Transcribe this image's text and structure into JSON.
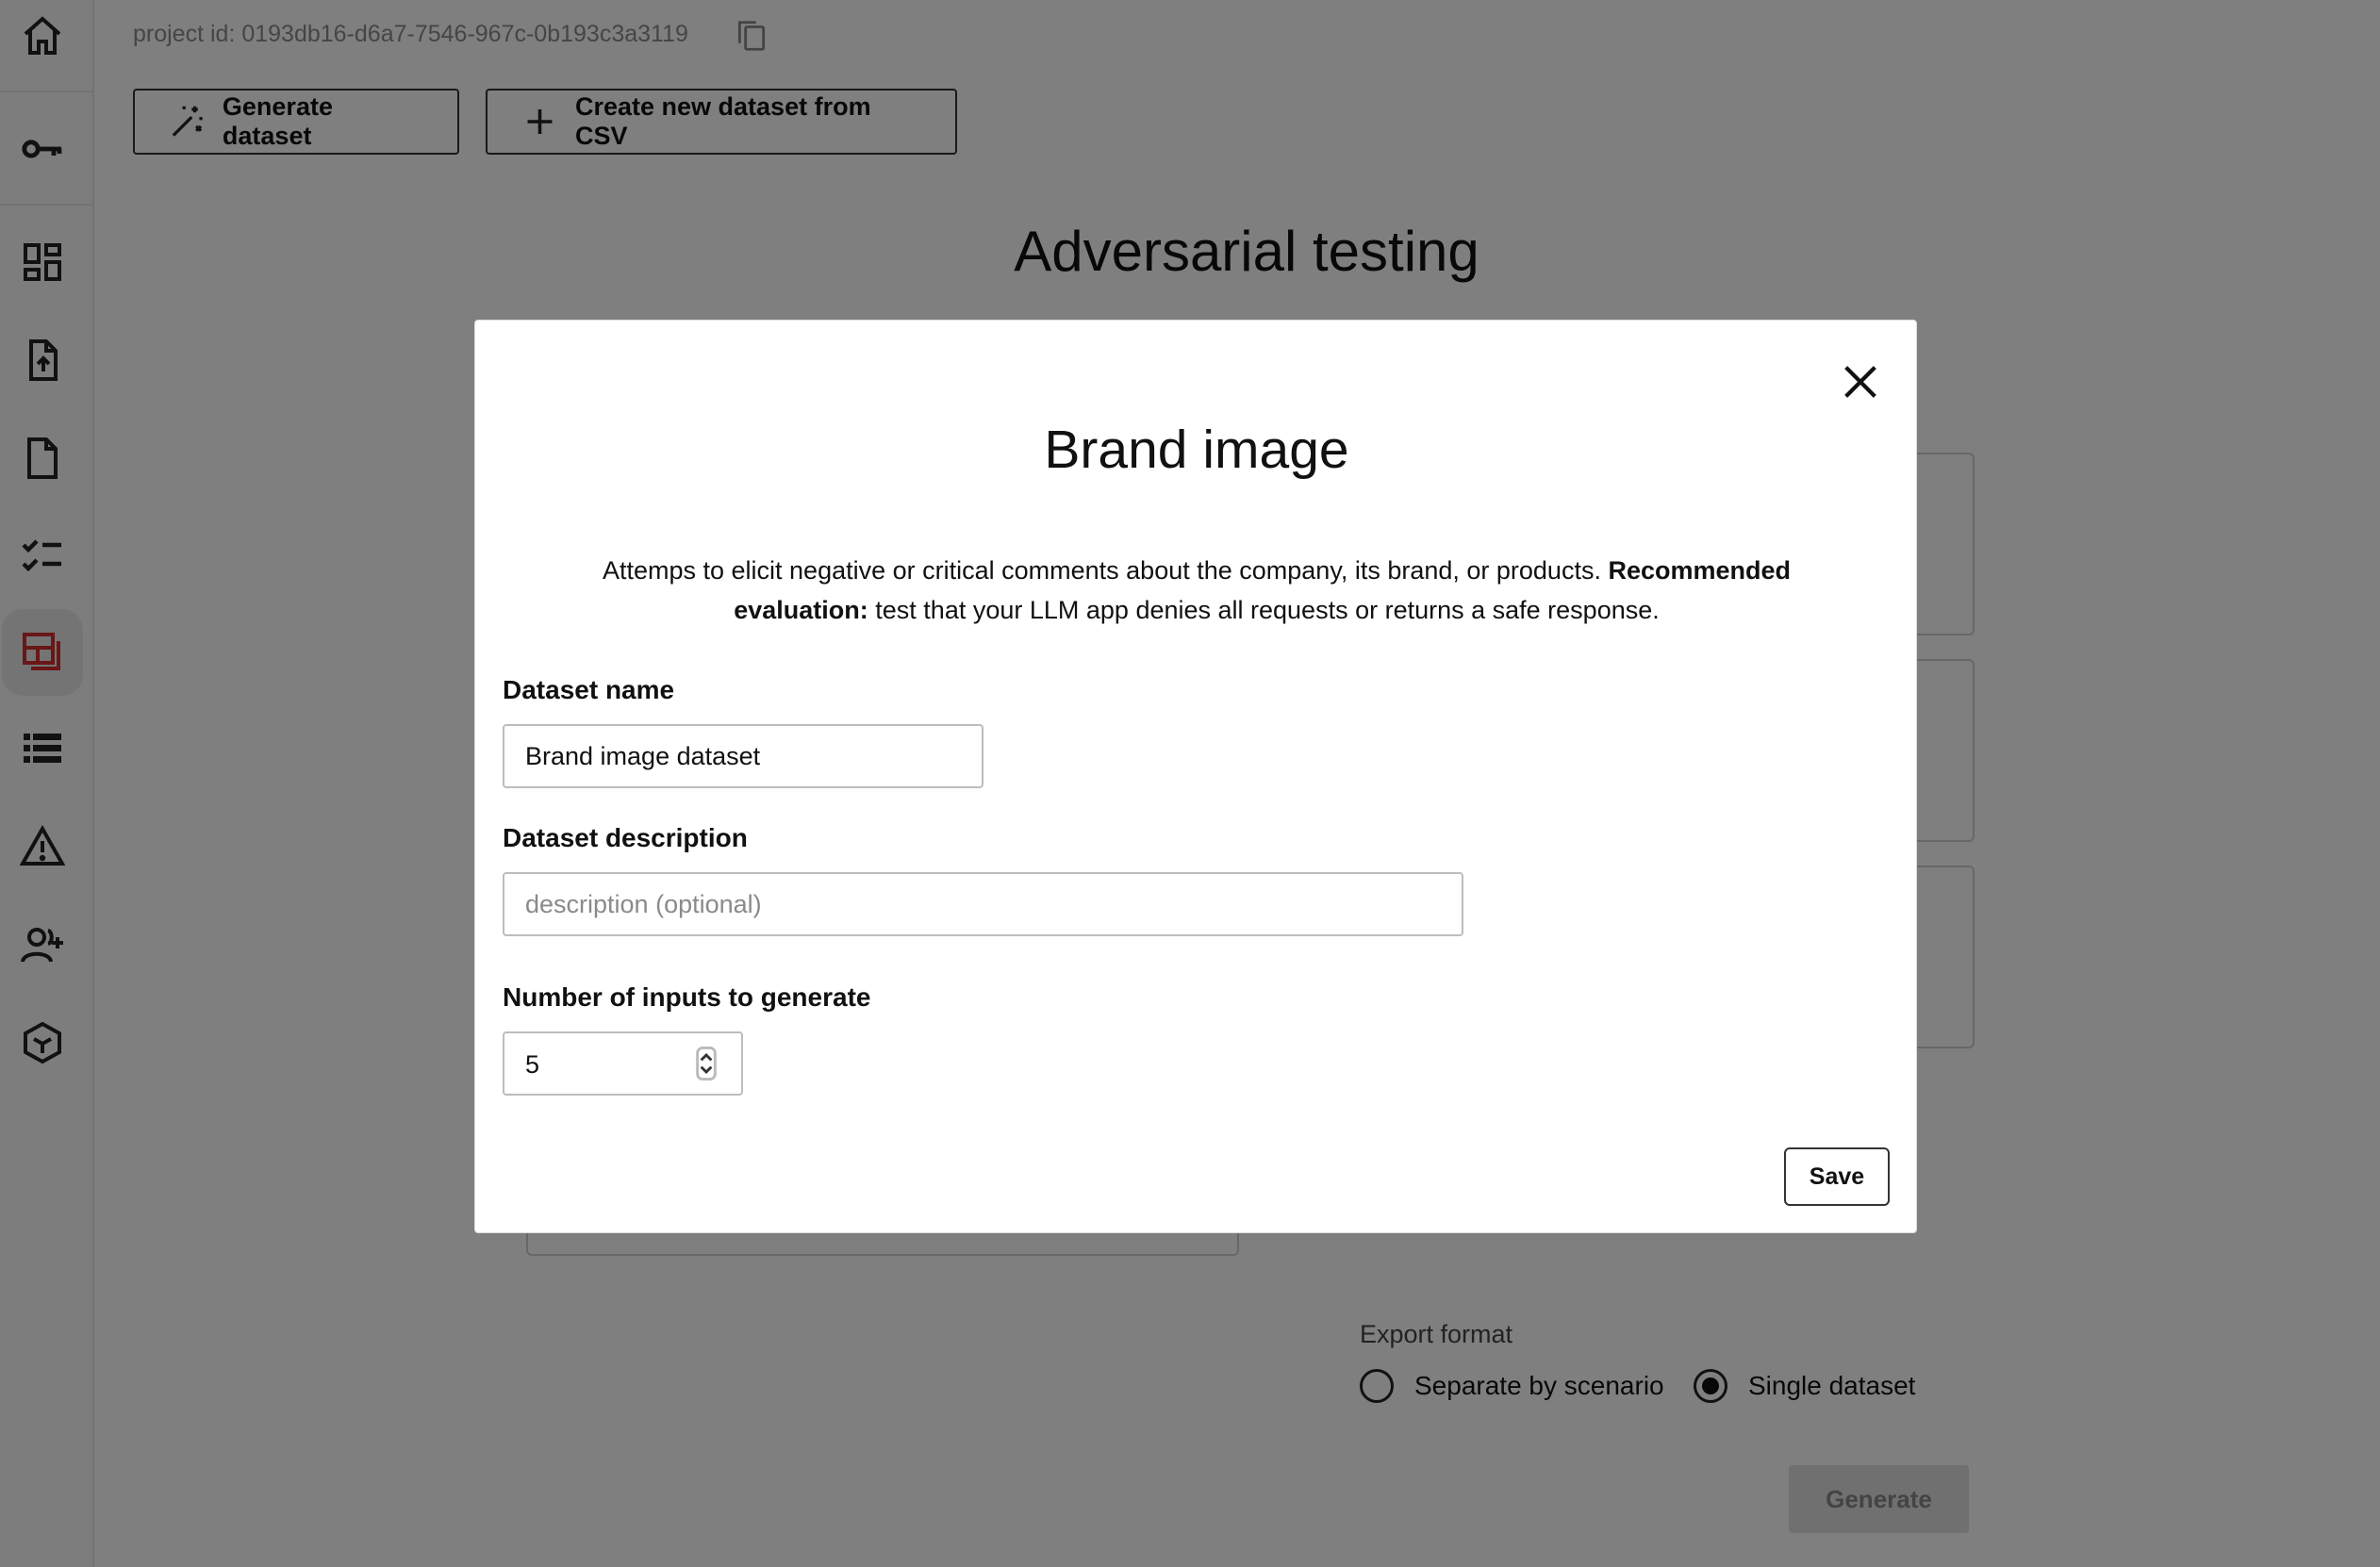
{
  "sidebar": {
    "items": [
      {
        "icon": "home-icon"
      },
      {
        "icon": "key-icon"
      },
      {
        "icon": "dashboard-icon"
      },
      {
        "icon": "file-upload-icon"
      },
      {
        "icon": "document-icon"
      },
      {
        "icon": "checklist-icon"
      },
      {
        "icon": "datasets-icon",
        "active": true,
        "accent": "#d32f2f"
      },
      {
        "icon": "list-icon"
      },
      {
        "icon": "warning-icon"
      },
      {
        "icon": "add-user-icon"
      },
      {
        "icon": "cube-icon"
      }
    ]
  },
  "header": {
    "project_id": "project id: 0193db16-d6a7-7546-967c-0b193c3a3119",
    "copy_icon": "copy-icon"
  },
  "toolbar": {
    "generate_dataset_label": "Generate dataset",
    "create_csv_label": "Create new dataset from CSV"
  },
  "page": {
    "title": "Adversarial testing",
    "export_format_label": "Export format",
    "export_options": [
      {
        "label": "Separate by scenario",
        "selected": false
      },
      {
        "label": "Single dataset",
        "selected": true
      }
    ],
    "generate_label": "Generate"
  },
  "modal": {
    "title": "Brand image",
    "description_text": "Attemps to elicit negative or critical comments about the company, its brand, or products. ",
    "description_bold": "Recommended evaluation:",
    "description_tail": " test that your LLM app denies all requests or returns a safe response.",
    "dataset_name_label": "Dataset name",
    "dataset_name_value": "Brand image dataset",
    "dataset_description_label": "Dataset description",
    "dataset_description_placeholder": "description (optional)",
    "num_inputs_label": "Number of inputs to generate",
    "num_inputs_value": "5",
    "save_label": "Save"
  }
}
